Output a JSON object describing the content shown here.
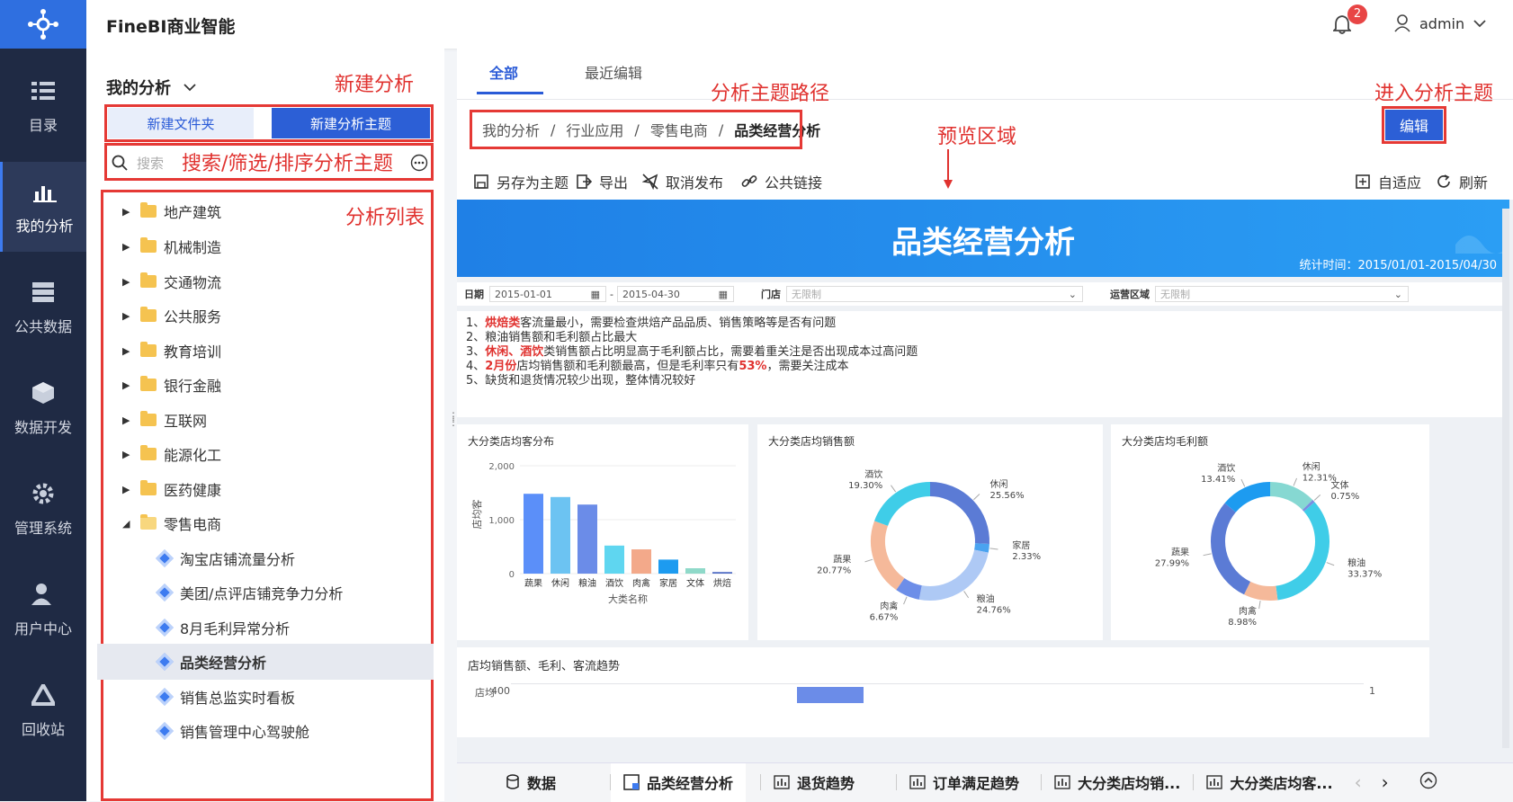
{
  "app": {
    "title": "FineBI商业智能",
    "notifications": "2",
    "user": "admin"
  },
  "nav": [
    {
      "label": "目录",
      "icon": "catalog-icon"
    },
    {
      "label": "我的分析",
      "icon": "chart-icon"
    },
    {
      "label": "公共数据",
      "icon": "database-icon"
    },
    {
      "label": "数据开发",
      "icon": "cube-icon"
    },
    {
      "label": "管理系统",
      "icon": "gear-icon"
    },
    {
      "label": "用户中心",
      "icon": "user-icon"
    },
    {
      "label": "回收站",
      "icon": "recycle-icon"
    }
  ],
  "sidebar": {
    "title": "我的分析",
    "new_folder": "新建文件夹",
    "new_theme": "新建分析主题",
    "search_placeholder": "搜索",
    "folders": [
      "地产建筑",
      "机械制造",
      "交通物流",
      "公共服务",
      "教育培训",
      "银行金融",
      "互联网",
      "能源化工",
      "医药健康",
      "零售电商"
    ],
    "items": [
      "淘宝店铺流量分析",
      "美团/点评店铺竞争力分析",
      "8月毛利异常分析",
      "品类经营分析",
      "销售总监实时看板",
      "销售管理中心驾驶舱"
    ]
  },
  "annotations": {
    "new_analysis": "新建分析",
    "search_filter": "搜索/筛选/排序分析主题",
    "list": "分析列表",
    "path": "分析主题路径",
    "preview": "预览区域",
    "enter": "进入分析主题"
  },
  "main": {
    "tabs": [
      "全部",
      "最近编辑"
    ],
    "breadcrumb": [
      "我的分析",
      "行业应用",
      "零售电商",
      "品类经营分析"
    ],
    "edit": "编辑",
    "tools": [
      "另存为主题",
      "导出",
      "取消发布",
      "公共链接"
    ],
    "tools_right": [
      "自适应",
      "刷新"
    ]
  },
  "dashboard": {
    "title": "品类经营分析",
    "stat_time": "统计时间：2015/01/01-2015/04/30",
    "filters": {
      "date_label": "日期",
      "date_from": "2015-01-01",
      "date_to": "2015-04-30",
      "store_label": "门店",
      "store_value": "无限制",
      "region_label": "运营区域",
      "region_value": "无限制"
    },
    "notes": [
      {
        "pre": "1、",
        "hl": "烘焙类",
        "post": "客流量最小，需要检查烘焙产品品质、销售策略等是否有问题"
      },
      {
        "pre": "2、",
        "hl": "",
        "post": "粮油销售额和毛利额占比最大"
      },
      {
        "pre": "3、",
        "hl": "休闲、酒饮",
        "post": "类销售额占比明显高于毛利额占比，需要着重关注是否出现成本过高问题"
      },
      {
        "pre": "4、",
        "hl": "2月份",
        "post": "店均销售额和毛利额最高，但是毛利率只有",
        "hl2": "53%",
        "post2": "，需要关注成本"
      },
      {
        "pre": "5、",
        "hl": "",
        "post": "缺货和退货情况较少出现，整体情况较好"
      }
    ],
    "panel_titles": [
      "大分类店均客分布",
      "大分类店均销售额",
      "大分类店均毛利额",
      "店均销售额、毛利、客流趋势"
    ],
    "trend_tick": "400",
    "trend_axis": "店均",
    "trend_right": "1"
  },
  "chart_data": [
    {
      "type": "bar",
      "title": "大分类店均客分布",
      "xlabel": "大类名称",
      "ylabel": "店均客",
      "categories": [
        "蔬果",
        "休闲",
        "粮油",
        "酒饮",
        "肉禽",
        "家居",
        "文体",
        "烘焙"
      ],
      "values": [
        1480,
        1420,
        1280,
        520,
        450,
        260,
        100,
        30
      ],
      "ylim": [
        0,
        2000
      ],
      "yticks": [
        "2,000",
        "1,000",
        "0"
      ],
      "colors": [
        "#5b8ff9",
        "#6cc3f2",
        "#6b8ce8",
        "#5fd6f0",
        "#f3a98a",
        "#1d9bf0",
        "#8fd9c9",
        "#5470c6"
      ]
    },
    {
      "type": "pie",
      "title": "大分类店均销售额",
      "slices": [
        {
          "name": "休闲",
          "value": 25.56,
          "label": "25.56%",
          "color": "#5b7bd5"
        },
        {
          "name": "家居",
          "value": 2.33,
          "label": "2.33%",
          "color": "#4aa3f0"
        },
        {
          "name": "粮油",
          "value": 24.76,
          "label": "24.76%",
          "color": "#aec9f5"
        },
        {
          "name": "肉禽",
          "value": 6.67,
          "label": "6.67%",
          "color": "#6d8ee8"
        },
        {
          "name": "蔬果",
          "value": 20.77,
          "label": "20.77%",
          "color": "#f5b99a"
        },
        {
          "name": "酒饮",
          "value": 19.3,
          "label": "19.30%",
          "color": "#3fcde8"
        }
      ]
    },
    {
      "type": "pie",
      "title": "大分类店均毛利额",
      "slices": [
        {
          "name": "休闲",
          "value": 12.31,
          "label": "12.31%",
          "color": "#86d8d2"
        },
        {
          "name": "文体",
          "value": 0.75,
          "label": "0.75%",
          "color": "#7b8de0"
        },
        {
          "name": "粮油",
          "value": 33.37,
          "label": "33.37%",
          "color": "#3fcde8"
        },
        {
          "name": "肉禽",
          "value": 8.98,
          "label": "8.98%",
          "color": "#f5b99a"
        },
        {
          "name": "蔬果",
          "value": 27.99,
          "label": "27.99%",
          "color": "#5b7bd5"
        },
        {
          "name": "酒饮",
          "value": 13.41,
          "label": "13.41%",
          "color": "#1d9bf0"
        }
      ]
    }
  ],
  "bottom": {
    "tabs": [
      "数据",
      "品类经营分析",
      "退货趋势",
      "订单满足趋势",
      "大分类店均销...",
      "大分类店均客..."
    ]
  }
}
